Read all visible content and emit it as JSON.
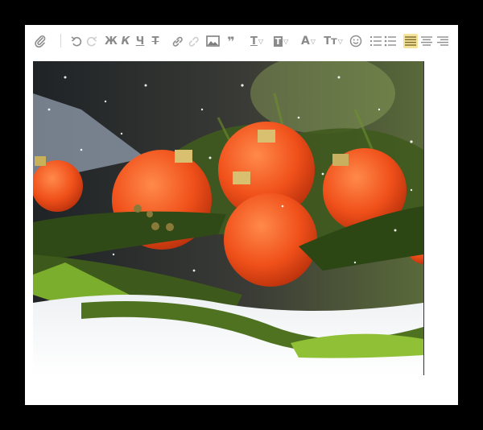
{
  "toolbar": {
    "attach_icon": "paperclip-icon",
    "undo_icon": "undo-icon",
    "redo_icon": "redo-icon",
    "bold_label": "Ж",
    "italic_label": "К",
    "underline_label": "Ч",
    "strike_label": "Т",
    "link_icon": "link-icon",
    "unlink_icon": "unlink-icon",
    "image_icon": "image-icon",
    "quote_label": "❞",
    "text_style_label": "T",
    "text_box_label": "T",
    "font_color_label": "A",
    "font_size_label": "Tт",
    "emoji_icon": "smiley-icon",
    "ordered_list_icon": "ordered-list-icon",
    "unordered_list_icon": "unordered-list-icon",
    "align_left_icon": "align-left-icon",
    "align_center_icon": "align-center-icon",
    "align_right_icon": "align-right-icon",
    "active_color": "#f6e39a"
  },
  "content": {
    "image_subject": "christmas-ornaments-photo"
  }
}
